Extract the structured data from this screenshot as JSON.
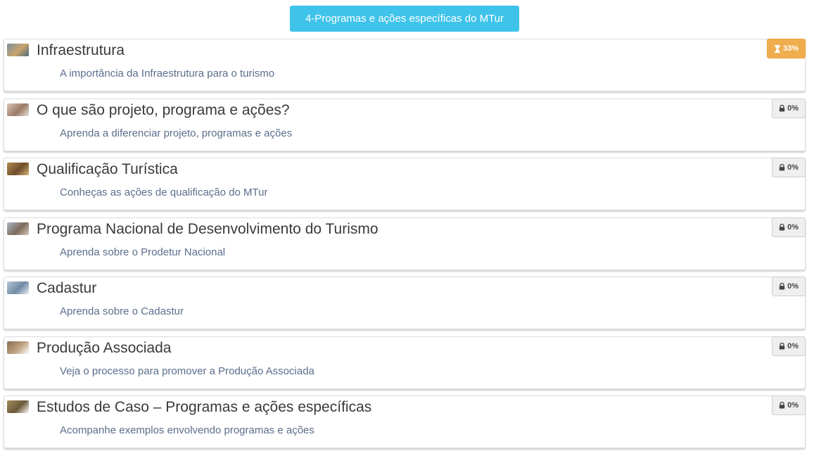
{
  "header": {
    "button_label": "4-Programas e ações específicas do MTur"
  },
  "items": [
    {
      "title": "Infraestrutura",
      "subtitle": "A importância da Infraestrutura para o turismo",
      "badge": "33%",
      "status": "in-progress",
      "thumb_colors": [
        "#7a8ea0",
        "#c9a56a",
        "#4e6a7e"
      ]
    },
    {
      "title": "O que são projeto, programa e ações?",
      "subtitle": "Aprenda a diferenciar projeto, programas e ações",
      "badge": "0%",
      "status": "locked",
      "thumb_colors": [
        "#d8c4b4",
        "#9a7a66",
        "#e9e0d8"
      ]
    },
    {
      "title": "Qualificação Turística",
      "subtitle": "Conheças as ações de qualificação do MTur",
      "badge": "0%",
      "status": "locked",
      "thumb_colors": [
        "#b38a4f",
        "#6e4e2c",
        "#d9b27a"
      ]
    },
    {
      "title": "Programa Nacional de Desenvolvimento do Turismo",
      "subtitle": "Aprenda sobre o Prodetur Nacional",
      "badge": "0%",
      "status": "locked",
      "thumb_colors": [
        "#a9b7c9",
        "#7c6a5a",
        "#d3c9bd"
      ]
    },
    {
      "title": "Cadastur",
      "subtitle": "Aprenda sobre o Cadastur",
      "badge": "0%",
      "status": "locked",
      "thumb_colors": [
        "#b9c8d6",
        "#6f8aa4",
        "#e6edf3"
      ]
    },
    {
      "title": "Produção Associada",
      "subtitle": "Veja o processo para promover a Produção Associada",
      "badge": "0%",
      "status": "locked",
      "thumb_colors": [
        "#8a6b52",
        "#c0a283",
        "#ffffff"
      ]
    },
    {
      "title": "Estudos de Caso – Programas e ações específicas",
      "subtitle": "Acompanhe exemplos envolvendo programas e ações",
      "badge": "0%",
      "status": "locked",
      "thumb_colors": [
        "#a48a5c",
        "#6a5a3a",
        "#ffffff"
      ]
    }
  ],
  "colors": {
    "header_bg": "#3fc3ea",
    "progress_badge": "#f0ad4e",
    "locked_badge": "#efefef",
    "subtitle": "#5b6e8c"
  }
}
